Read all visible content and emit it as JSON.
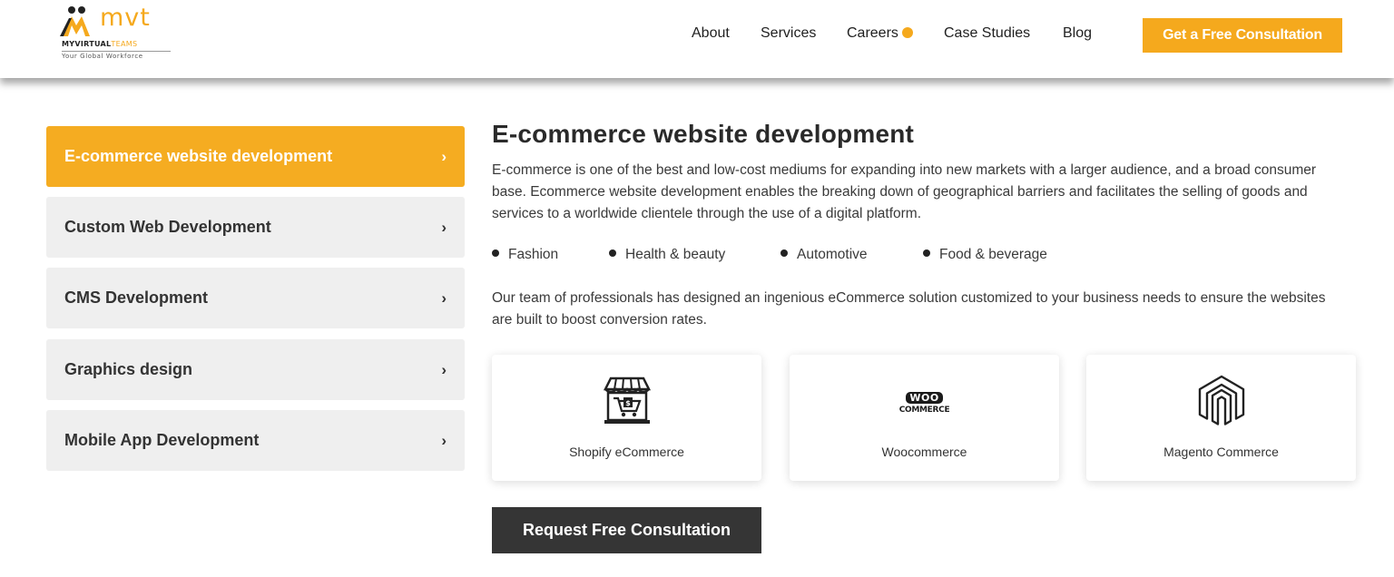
{
  "header": {
    "logo": {
      "wordmark": "mvt",
      "brand_dark": "MYVIRTUAL",
      "brand_accent": "TEAMS",
      "tagline": "Your Global Workforce"
    },
    "nav": [
      {
        "label": "About"
      },
      {
        "label": "Services"
      },
      {
        "label": "Careers"
      },
      {
        "label": "Case Studies"
      },
      {
        "label": "Blog"
      }
    ],
    "cta_label": "Get a Free Consultation"
  },
  "sidebar": {
    "items": [
      {
        "label": "E-commerce website development",
        "active": true
      },
      {
        "label": "Custom Web Development",
        "active": false
      },
      {
        "label": "CMS Development",
        "active": false
      },
      {
        "label": "Graphics design",
        "active": false
      },
      {
        "label": "Mobile App Development",
        "active": false
      }
    ],
    "chevron": "›"
  },
  "main": {
    "title": "E-commerce website development",
    "intro": "E-commerce is one of the best and low-cost mediums for expanding into new markets with a larger audience, and a broad consumer base. Ecommerce website development enables the breaking down of geographical barriers and facilitates the selling of goods and services to a worldwide clientele through the use of a digital platform.",
    "bullets": [
      "Fashion",
      "Health & beauty",
      "Automotive",
      "Food & beverage"
    ],
    "body": "Our team of professionals has designed an ingenious eCommerce solution customized to your business needs to ensure the websites are built to boost conversion rates.",
    "platforms": [
      {
        "label": "Shopify eCommerce",
        "icon": "shopify-store-icon"
      },
      {
        "label": "Woocommerce",
        "icon": "woocommerce-logo-icon",
        "logo_top": "WOO",
        "logo_bottom": "COMMERCE"
      },
      {
        "label": "Magento Commerce",
        "icon": "magento-logo-icon"
      }
    ],
    "request_label": "Request Free Consultation"
  },
  "colors": {
    "accent": "#f5a91d",
    "dark_button": "#353535",
    "sidebar_bg": "#efefef"
  }
}
